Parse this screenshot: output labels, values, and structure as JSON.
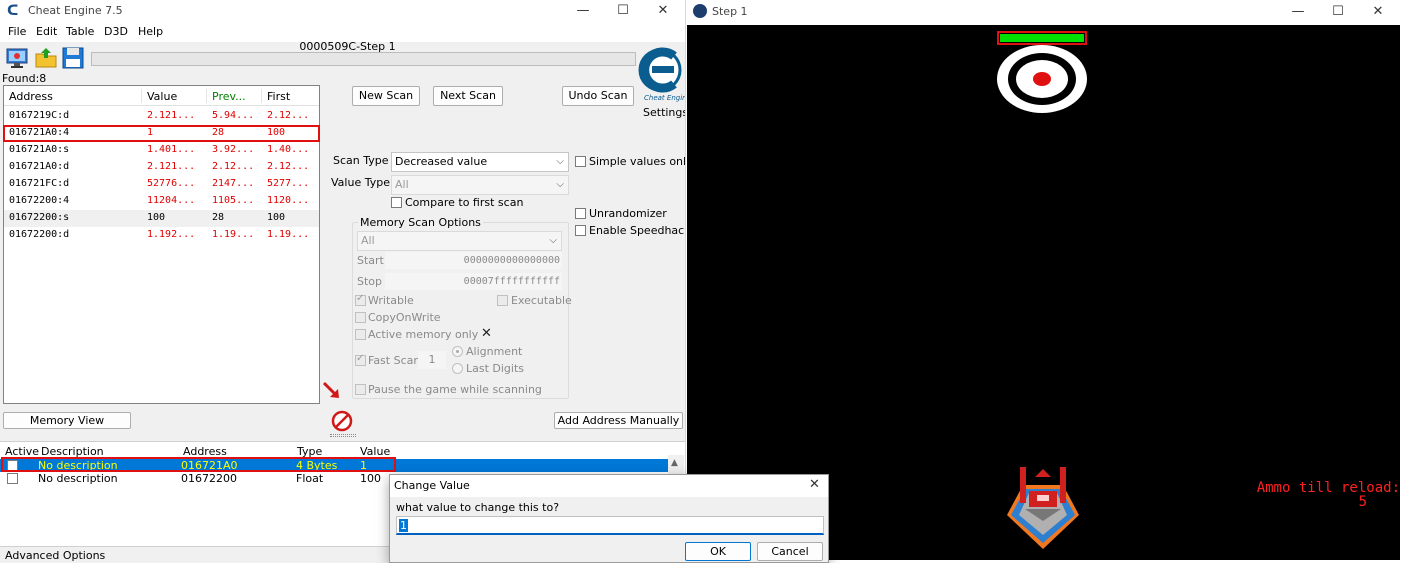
{
  "ce": {
    "title": "Cheat Engine 7.5",
    "menu": [
      "File",
      "Edit",
      "Table",
      "D3D",
      "Help"
    ],
    "process_title": "0000509C-Step 1",
    "found_label": "Found:8",
    "settings_label": "Settings",
    "logo_caption": "Cheat Engine",
    "results": {
      "columns": [
        "Address",
        "Value",
        "Prev...",
        "First"
      ],
      "rows": [
        {
          "address": "0167219C:d",
          "value": "2.121...",
          "prev": "5.94...",
          "first": "2.12..."
        },
        {
          "address": "016721A0:4",
          "value": "1",
          "prev": "28",
          "first": "100"
        },
        {
          "address": "016721A0:s",
          "value": "1.401...",
          "prev": "3.92...",
          "first": "1.40..."
        },
        {
          "address": "016721A0:d",
          "value": "2.121...",
          "prev": "2.12...",
          "first": "2.12..."
        },
        {
          "address": "016721FC:d",
          "value": "52776...",
          "prev": "2147...",
          "first": "5277..."
        },
        {
          "address": "01672200:4",
          "value": "11204...",
          "prev": "1105...",
          "first": "1120..."
        },
        {
          "address": "01672200:s",
          "value": "100",
          "prev": "28",
          "first": "100"
        },
        {
          "address": "01672200:d",
          "value": "1.192...",
          "prev": "1.19...",
          "first": "1.19..."
        }
      ]
    },
    "buttons": {
      "new_scan": "New Scan",
      "next_scan": "Next Scan",
      "undo_scan": "Undo Scan",
      "memory_view": "Memory View",
      "add_address": "Add Address Manually"
    },
    "scan": {
      "scan_type_label": "Scan Type",
      "scan_type_value": "Decreased value",
      "value_type_label": "Value Type",
      "value_type_value": "All",
      "compare_first": "Compare to first scan",
      "simple_values": "Simple values only",
      "unrandomizer": "Unrandomizer",
      "speedhack": "Enable Speedhack"
    },
    "mem_options": {
      "title": "Memory Scan Options",
      "region": "All",
      "start_label": "Start",
      "start_value": "0000000000000000",
      "stop_label": "Stop",
      "stop_value": "00007fffffffffff",
      "writable": "Writable",
      "executable": "Executable",
      "copy_on_write": "CopyOnWrite",
      "active_memory": "Active memory only",
      "fast_scan": "Fast Scan",
      "fast_scan_value": "1",
      "alignment": "Alignment",
      "last_digits": "Last Digits",
      "pause_game": "Pause the game while scanning"
    },
    "address_table": {
      "columns": [
        "Active",
        "Description",
        "Address",
        "Type",
        "Value"
      ],
      "rows": [
        {
          "description": "No description",
          "address": "016721A0",
          "type": "4 Bytes",
          "value": "1"
        },
        {
          "description": "No description",
          "address": "01672200",
          "type": "Float",
          "value": "100"
        }
      ]
    },
    "advanced_options": "Advanced Options"
  },
  "game": {
    "title": "Step 1",
    "ammo_label": "Ammo till reload:",
    "ammo_value": "5",
    "health_fraction": 1.0
  },
  "dialog": {
    "title": "Change Value",
    "prompt": "what value to change this to?",
    "input_value": "1",
    "ok": "OK",
    "cancel": "Cancel"
  },
  "colors": {
    "changed_value": "#e00000",
    "selection": "#0078d7",
    "selected_text": "#ffff00",
    "health_bar": "#00e000",
    "ammo_text": "#ff2020",
    "prev_header": "#008000"
  }
}
